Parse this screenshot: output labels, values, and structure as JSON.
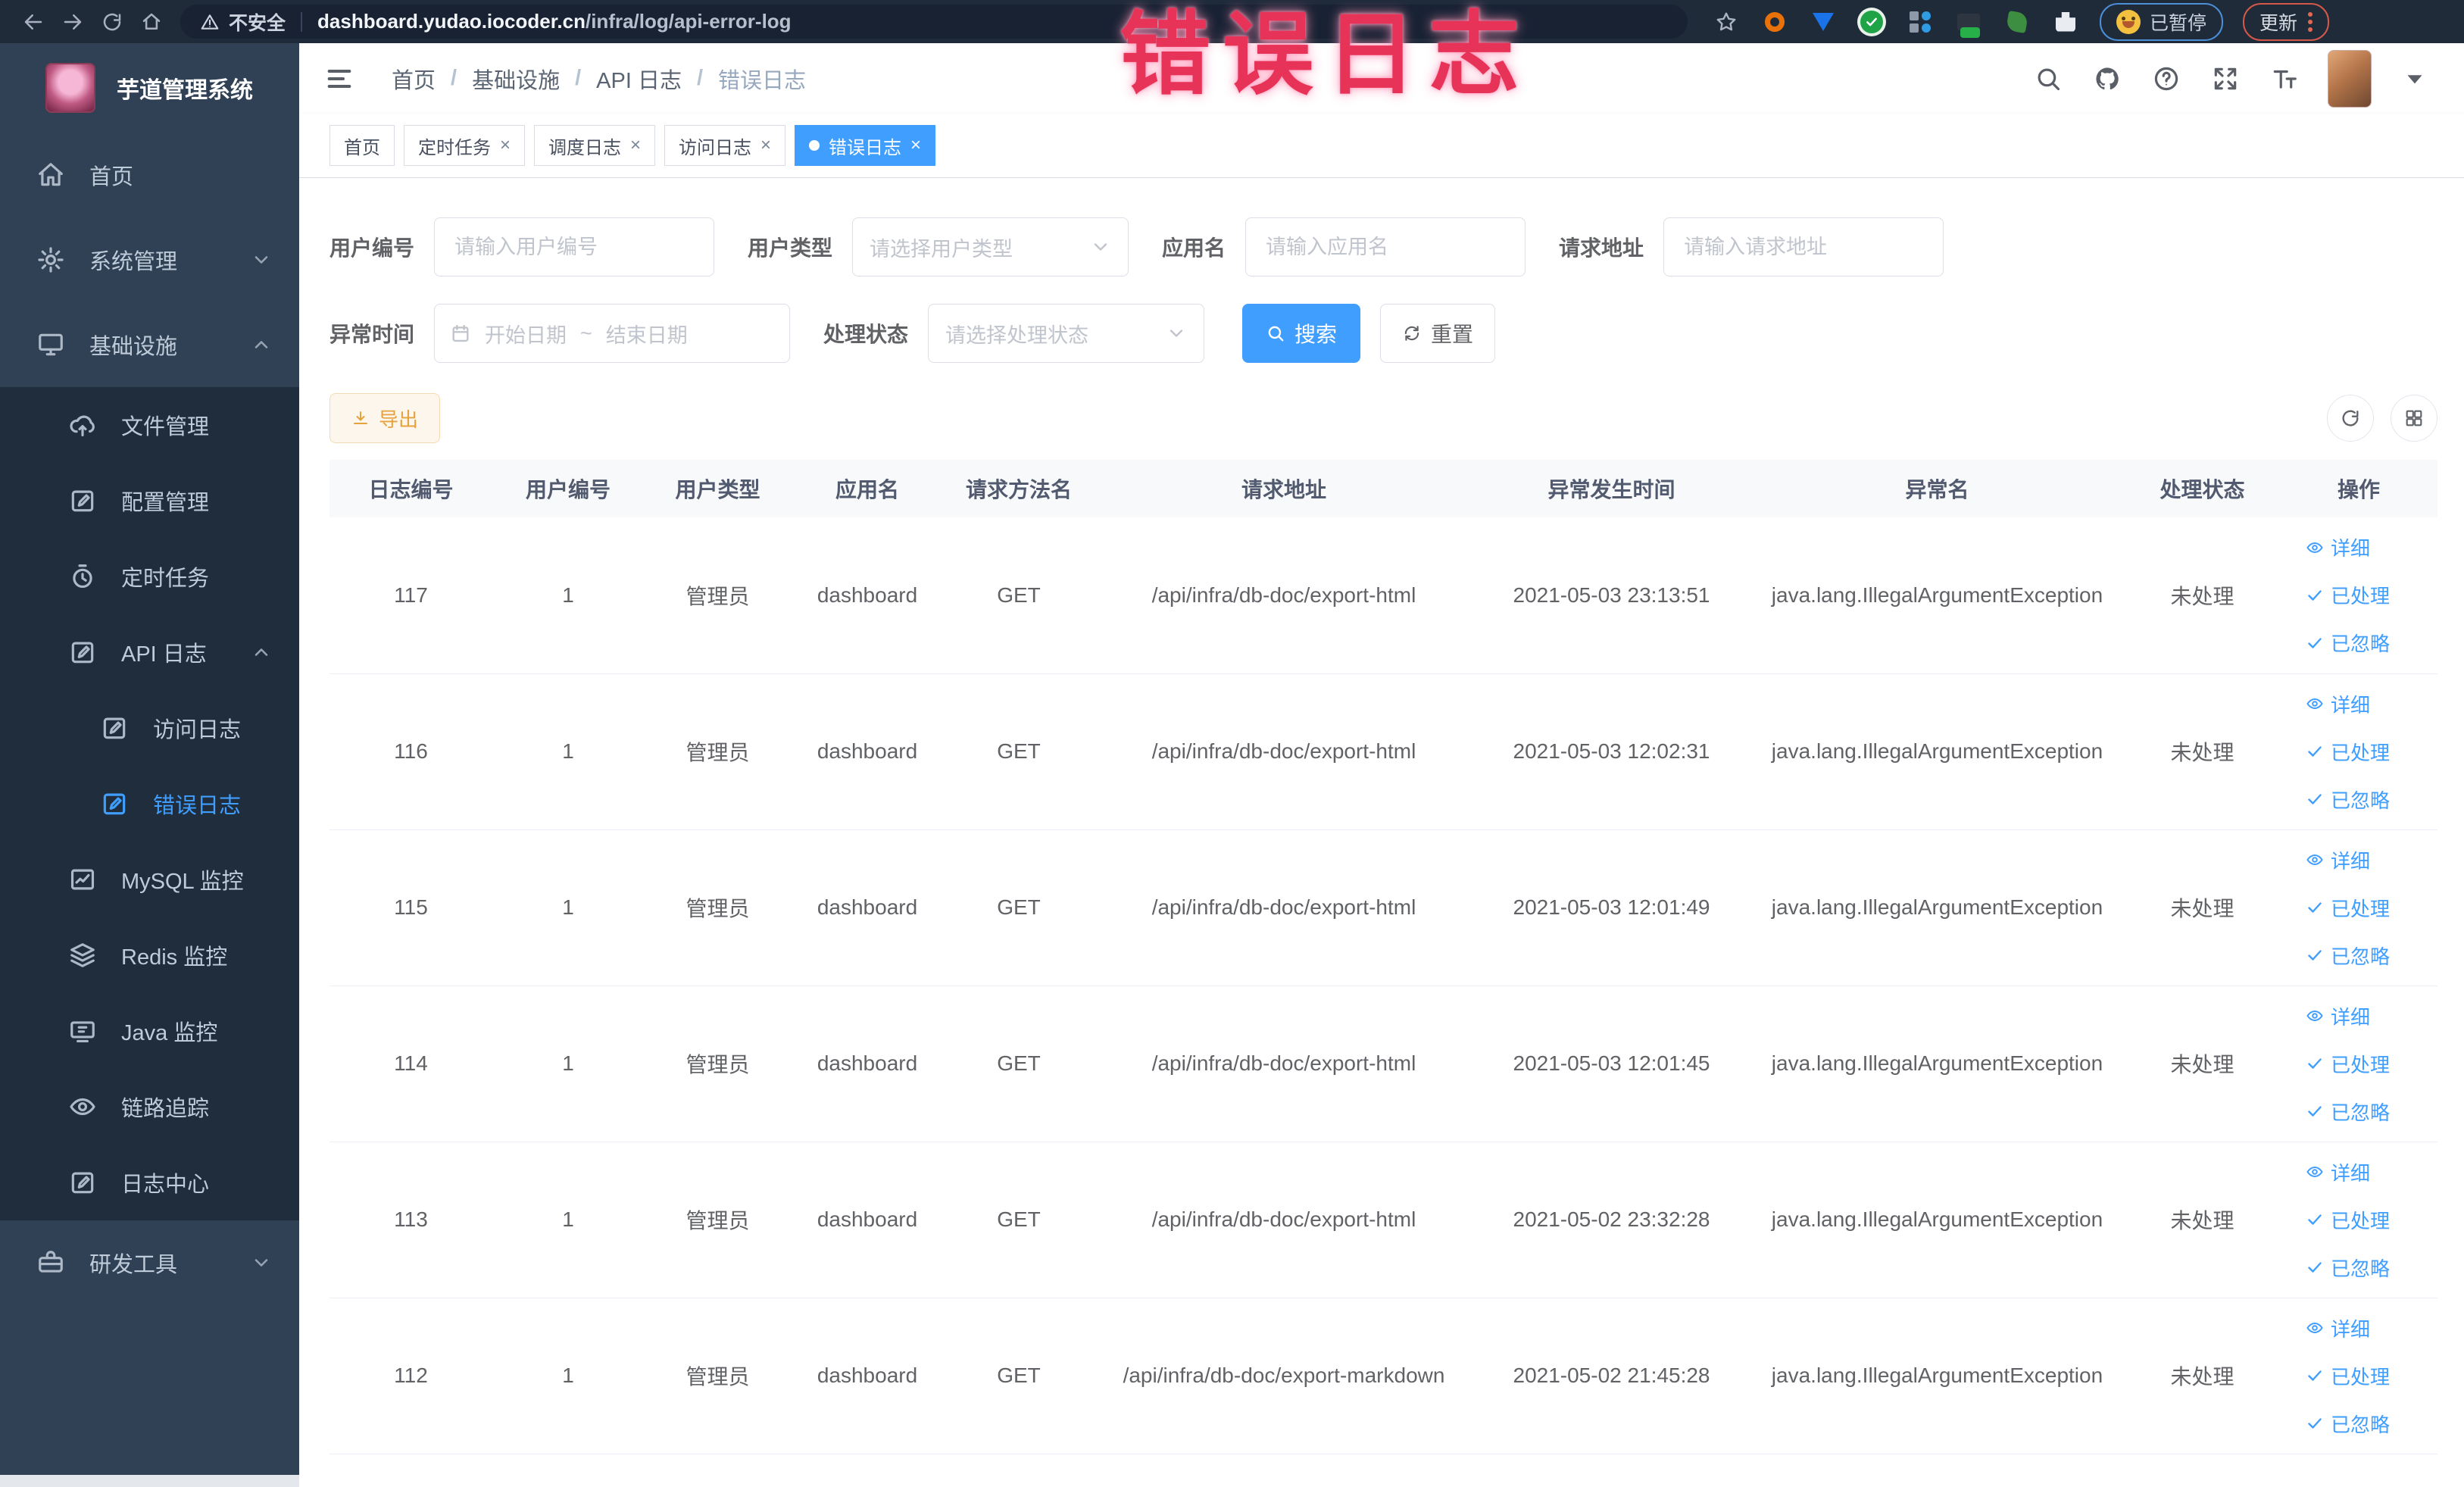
{
  "browser": {
    "security_label": "不安全",
    "url_host": "dashboard.yudao.iocoder.cn",
    "url_path": "/infra/log/api-error-log",
    "paused_badge": "已暂停",
    "update_button": "更新"
  },
  "annotation": {
    "text": "错误日志",
    "color": "#e73357"
  },
  "sidebar": {
    "title": "芋道管理系统",
    "items": [
      {
        "label": "首页",
        "level": 1
      },
      {
        "label": "系统管理",
        "level": 1,
        "expandable": true,
        "expanded": false
      },
      {
        "label": "基础设施",
        "level": 1,
        "expandable": true,
        "expanded": true
      },
      {
        "label": "文件管理",
        "level": 2
      },
      {
        "label": "配置管理",
        "level": 2
      },
      {
        "label": "定时任务",
        "level": 2
      },
      {
        "label": "API 日志",
        "level": 2,
        "expandable": true,
        "expanded": true
      },
      {
        "label": "访问日志",
        "level": 3
      },
      {
        "label": "错误日志",
        "level": 3,
        "active": true
      },
      {
        "label": "MySQL 监控",
        "level": 2
      },
      {
        "label": "Redis 监控",
        "level": 2
      },
      {
        "label": "Java 监控",
        "level": 2
      },
      {
        "label": "链路追踪",
        "level": 2
      },
      {
        "label": "日志中心",
        "level": 2
      },
      {
        "label": "研发工具",
        "level": 1,
        "expandable": true,
        "expanded": false
      }
    ]
  },
  "breadcrumb": {
    "items": [
      "首页",
      "基础设施",
      "API 日志",
      "错误日志"
    ]
  },
  "tabs": [
    {
      "label": "首页",
      "closable": false,
      "active": false
    },
    {
      "label": "定时任务",
      "closable": true,
      "active": false
    },
    {
      "label": "调度日志",
      "closable": true,
      "active": false
    },
    {
      "label": "访问日志",
      "closable": true,
      "active": false
    },
    {
      "label": "错误日志",
      "closable": true,
      "active": true
    }
  ],
  "filters": {
    "user_id_label": "用户编号",
    "user_id_placeholder": "请输入用户编号",
    "user_type_label": "用户类型",
    "user_type_placeholder": "请选择用户类型",
    "app_name_label": "应用名",
    "app_name_placeholder": "请输入应用名",
    "request_url_label": "请求地址",
    "request_url_placeholder": "请输入请求地址",
    "exception_time_label": "异常时间",
    "date_start_placeholder": "开始日期",
    "date_separator": "~",
    "date_end_placeholder": "结束日期",
    "process_status_label": "处理状态",
    "process_status_placeholder": "请选择处理状态",
    "search_button": "搜索",
    "reset_button": "重置"
  },
  "toolbar": {
    "export_button": "导出"
  },
  "table": {
    "columns": [
      "日志编号",
      "用户编号",
      "用户类型",
      "应用名",
      "请求方法名",
      "请求地址",
      "异常发生时间",
      "异常名",
      "处理状态",
      "操作"
    ],
    "actions": {
      "detail": "详细",
      "processed": "已处理",
      "ignored": "已忽略"
    },
    "rows": [
      {
        "id": "117",
        "user_id": "1",
        "user_type": "管理员",
        "app_name": "dashboard",
        "method": "GET",
        "url": "/api/infra/db-doc/export-html",
        "time": "2021-05-03 23:13:51",
        "exception": "java.lang.IllegalArgumentException",
        "status": "未处理"
      },
      {
        "id": "116",
        "user_id": "1",
        "user_type": "管理员",
        "app_name": "dashboard",
        "method": "GET",
        "url": "/api/infra/db-doc/export-html",
        "time": "2021-05-03 12:02:31",
        "exception": "java.lang.IllegalArgumentException",
        "status": "未处理"
      },
      {
        "id": "115",
        "user_id": "1",
        "user_type": "管理员",
        "app_name": "dashboard",
        "method": "GET",
        "url": "/api/infra/db-doc/export-html",
        "time": "2021-05-03 12:01:49",
        "exception": "java.lang.IllegalArgumentException",
        "status": "未处理"
      },
      {
        "id": "114",
        "user_id": "1",
        "user_type": "管理员",
        "app_name": "dashboard",
        "method": "GET",
        "url": "/api/infra/db-doc/export-html",
        "time": "2021-05-03 12:01:45",
        "exception": "java.lang.IllegalArgumentException",
        "status": "未处理"
      },
      {
        "id": "113",
        "user_id": "1",
        "user_type": "管理员",
        "app_name": "dashboard",
        "method": "GET",
        "url": "/api/infra/db-doc/export-html",
        "time": "2021-05-02 23:32:28",
        "exception": "java.lang.IllegalArgumentException",
        "status": "未处理"
      },
      {
        "id": "112",
        "user_id": "1",
        "user_type": "管理员",
        "app_name": "dashboard",
        "method": "GET",
        "url": "/api/infra/db-doc/export-markdown",
        "time": "2021-05-02 21:45:28",
        "exception": "java.lang.IllegalArgumentException",
        "status": "未处理"
      }
    ]
  },
  "colors": {
    "accent": "#409eff",
    "warning": "#e6a23c",
    "sidebar_bg": "#304156",
    "sidebar_sub_bg": "#1f2d3d",
    "browser_bar": "#202b3a"
  }
}
